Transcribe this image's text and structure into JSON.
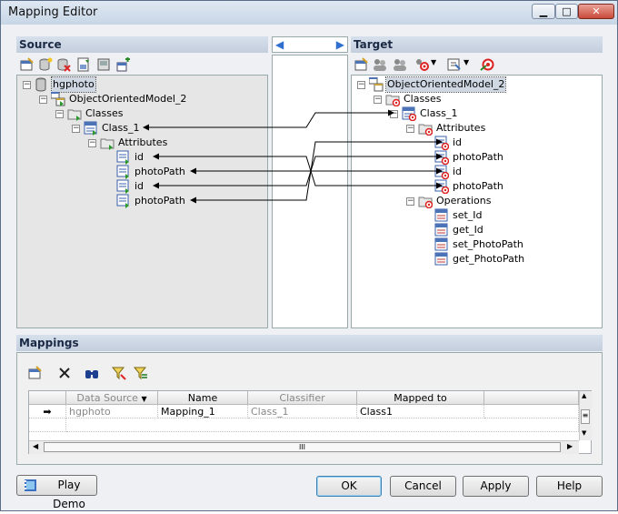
{
  "window": {
    "title": "Mapping Editor"
  },
  "colors": {
    "tree_selection": "#cfd7e3",
    "mapping_line": "#000000",
    "panel_header": "#c3cedd"
  },
  "source": {
    "header": "Source",
    "toolbar_icons": [
      "properties-icon",
      "new-datasource-icon",
      "delete-icon",
      "export-icon",
      "import-icon",
      "add-mapping-icon"
    ],
    "tree": [
      {
        "label": "hgphoto",
        "icon": "database-icon",
        "selected": true
      },
      {
        "label": "ObjectOrientedModel_2",
        "icon": "model-icon"
      },
      {
        "label": "Classes",
        "icon": "folder-icon"
      },
      {
        "label": "Class_1",
        "icon": "class-icon"
      },
      {
        "label": "Attributes",
        "icon": "folder-icon"
      },
      {
        "label": "id",
        "icon": "attribute-icon"
      },
      {
        "label": "photoPath",
        "icon": "attribute-icon"
      },
      {
        "label": "id",
        "icon": "attribute-icon"
      },
      {
        "label": "photoPath",
        "icon": "attribute-icon"
      }
    ]
  },
  "middle": {
    "left_arrow": "◀",
    "right_arrow": "▶"
  },
  "target": {
    "header": "Target",
    "toolbar_icons": [
      "properties-icon",
      "users-icon",
      "users-filter-icon",
      "mapping-options-icon",
      "filter-dropdown-icon",
      "target-icon"
    ],
    "tree": [
      {
        "label": "ObjectOrientedModel_2",
        "icon": "model-icon",
        "selected": true
      },
      {
        "label": "Classes",
        "icon": "folder-icon"
      },
      {
        "label": "Class_1",
        "icon": "class-icon"
      },
      {
        "label": "Attributes",
        "icon": "folder-icon"
      },
      {
        "label": "id",
        "icon": "attribute-icon"
      },
      {
        "label": "photoPath",
        "icon": "attribute-icon"
      },
      {
        "label": "id",
        "icon": "attribute-icon"
      },
      {
        "label": "photoPath",
        "icon": "attribute-icon"
      },
      {
        "label": "Operations",
        "icon": "folder-icon"
      },
      {
        "label": "set_Id",
        "icon": "operation-icon"
      },
      {
        "label": "get_Id",
        "icon": "operation-icon"
      },
      {
        "label": "set_PhotoPath",
        "icon": "operation-icon"
      },
      {
        "label": "get_PhotoPath",
        "icon": "operation-icon"
      }
    ]
  },
  "mappings": {
    "header": "Mappings",
    "columns": [
      "Data Source",
      "Name",
      "Classifier",
      "Mapped to"
    ],
    "rows": [
      {
        "data_source": "hgphoto",
        "name": "Mapping_1",
        "classifier": "Class_1",
        "mapped_to": "Class1"
      }
    ],
    "scroll_grip": "III"
  },
  "buttons": {
    "play_demo": "Play Demo",
    "ok": "OK",
    "cancel": "Cancel",
    "apply": "Apply",
    "help": "Help"
  }
}
